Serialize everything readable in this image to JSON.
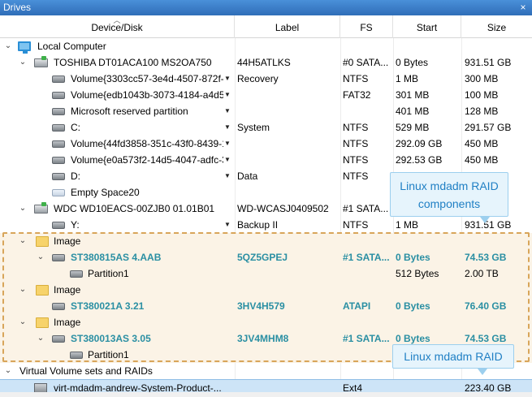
{
  "panel": {
    "title": "Drives",
    "close_glyph": "×"
  },
  "columns": {
    "device": "Device/Disk",
    "label": "Label",
    "fs": "FS",
    "start": "Start",
    "size": "Size"
  },
  "rows": {
    "local_computer": {
      "name": "Local Computer"
    },
    "toshiba": {
      "name": "TOSHIBA DT01ACA100 MS2OA750",
      "label": "44H5ATLKS",
      "fs": "#0 SATA...",
      "start": "0 Bytes",
      "size": "931.51 GB"
    },
    "vol1": {
      "name": "Volume{3303cc57-3e4d-4507-872f-...",
      "label": "Recovery",
      "fs": "NTFS",
      "start": "1 MB",
      "size": "300 MB"
    },
    "vol2": {
      "name": "Volume{edb1043b-3073-4184-a4d5-...",
      "label": "",
      "fs": "FAT32",
      "start": "301 MB",
      "size": "100 MB"
    },
    "msr": {
      "name": "Microsoft reserved partition",
      "label": "",
      "fs": "",
      "start": "401 MB",
      "size": "128 MB"
    },
    "c": {
      "name": "C:",
      "label": "System",
      "fs": "NTFS",
      "start": "529 MB",
      "size": "291.57 GB"
    },
    "vol3": {
      "name": "Volume{44fd3858-351c-43f0-8439-1...",
      "label": "",
      "fs": "NTFS",
      "start": "292.09 GB",
      "size": "450 MB"
    },
    "vol4": {
      "name": "Volume{e0a573f2-14d5-4047-adfc-3...",
      "label": "",
      "fs": "NTFS",
      "start": "292.53 GB",
      "size": "450 MB"
    },
    "d": {
      "name": "D:",
      "label": "Data",
      "fs": "NTFS",
      "start": "",
      "size": ""
    },
    "empty": {
      "name": "Empty Space20"
    },
    "wdc": {
      "name": "WDC WD10EACS-00ZJB0 01.01B01",
      "label": "WD-WCASJ0409502",
      "fs": "#1 SATA...",
      "start": "",
      "size": ""
    },
    "y": {
      "name": "Y:",
      "label": "Backup II",
      "fs": "NTFS",
      "start": "1 MB",
      "size": "931.51 GB"
    },
    "image1": {
      "name": "Image"
    },
    "st1": {
      "name": "ST380815AS 4.AAB",
      "label": "5QZ5GPEJ",
      "fs": "#1 SATA...",
      "start": "0 Bytes",
      "size": "74.53 GB"
    },
    "part1": {
      "name": "Partition1",
      "start": "512 Bytes",
      "size": "2.00 TB"
    },
    "image2": {
      "name": "Image"
    },
    "st2": {
      "name": "ST380021A 3.21",
      "label": "3HV4H579",
      "fs": "ATAPI",
      "start": "0 Bytes",
      "size": "76.40 GB"
    },
    "image3": {
      "name": "Image"
    },
    "st3": {
      "name": "ST380013AS 3.05",
      "label": "3JV4MHM8",
      "fs": "#1 SATA...",
      "start": "0 Bytes",
      "size": "74.53 GB"
    },
    "part2": {
      "name": "Partition1"
    },
    "virtual": {
      "name": "Virtual Volume sets and RAIDs"
    },
    "mdadm": {
      "name": "virt-mdadm-andrew-System-Product-...",
      "label": "",
      "fs": "Ext4",
      "start": "",
      "size": "223.40 GB"
    }
  },
  "callouts": {
    "components": "Linux mdadm RAID components",
    "raid": "Linux mdadm RAID"
  },
  "colors": {
    "accent": "#2a8fa3",
    "callout_text": "#1f7fc4",
    "dashed": "#d8a55a",
    "header": "#2f6db8"
  }
}
